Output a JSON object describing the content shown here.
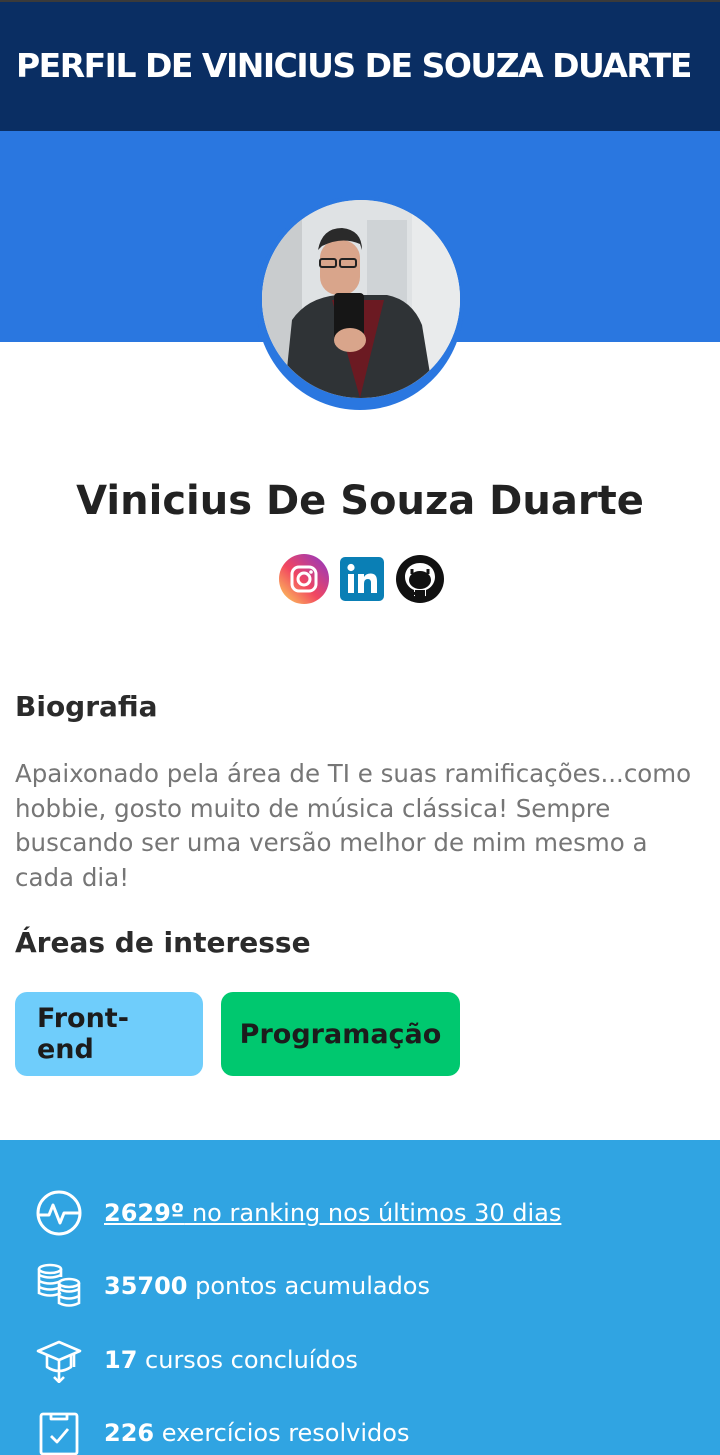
{
  "header": {
    "title": "PERFIL DE VINICIUS DE SOUZA DUARTE"
  },
  "profile": {
    "name": "Vinicius De Souza Duarte",
    "socials": [
      {
        "icon": "instagram-icon"
      },
      {
        "icon": "linkedin-icon"
      },
      {
        "icon": "github-icon"
      }
    ]
  },
  "bio": {
    "title": "Biografia",
    "text": "Apaixonado pela área de TI e suas ramificações...como hobbie, gosto muito de música clássica! Sempre buscando ser uma versão melhor de mim mesmo a cada dia!"
  },
  "interests": {
    "title": "Áreas de interesse",
    "tags": [
      "Front-end",
      "Programação"
    ]
  },
  "stats": [
    {
      "icon": "activity-icon",
      "value": "2629º",
      "label": " no ranking nos últimos 30 dias"
    },
    {
      "icon": "coins-icon",
      "value": "35700",
      "label": " pontos acumulados"
    },
    {
      "icon": "graduation-cap-icon",
      "value": "17",
      "label": " cursos concluídos"
    },
    {
      "icon": "clipboard-check-icon",
      "value": "226",
      "label": " exercícios resolvidos"
    }
  ],
  "colors": {
    "header": "#0a2e63",
    "hero": "#2a77e0",
    "stats_bg": "#30a4e2",
    "tag_frontend": "#6fcdfb",
    "tag_programacao": "#00c86f"
  }
}
